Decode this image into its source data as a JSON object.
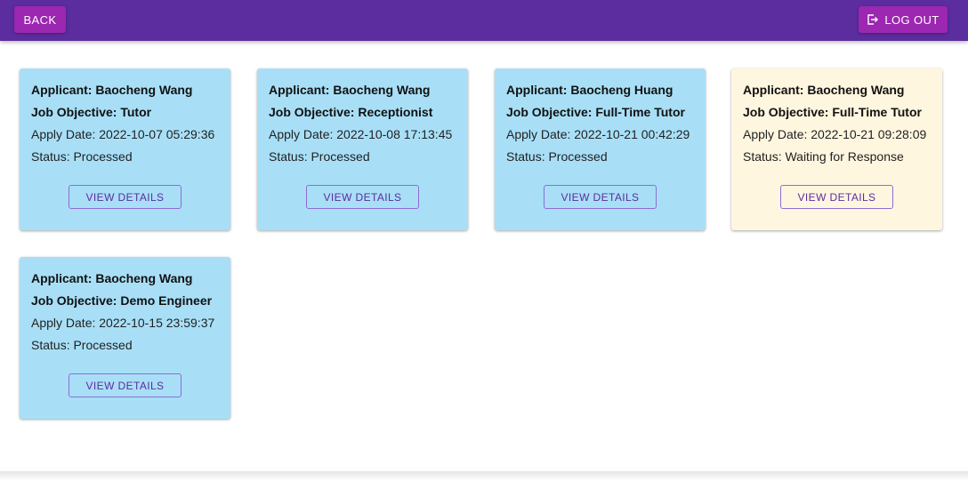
{
  "colors": {
    "appbar": "#5b2d9e",
    "top_button": "#9c27b0",
    "card_processed": "#a8dff7",
    "card_waiting": "#fff6df",
    "view_button_text": "#5b2d9e"
  },
  "header": {
    "back_label": "BACK",
    "logout_label": "LOG OUT",
    "logout_icon": "logout-icon"
  },
  "applications": [
    {
      "applicant": "Applicant: Baocheng Wang",
      "objective": "Job Objective: Tutor",
      "apply_date": "Apply Date: 2022-10-07 05:29:36",
      "status": "Status: Processed",
      "button_label": "VIEW DETAILS",
      "state": "processed"
    },
    {
      "applicant": "Applicant: Baocheng Wang",
      "objective": "Job Objective: Receptionist",
      "apply_date": "Apply Date: 2022-10-08 17:13:45",
      "status": "Status: Processed",
      "button_label": "VIEW DETAILS",
      "state": "processed"
    },
    {
      "applicant": "Applicant: Baocheng Huang",
      "objective": "Job Objective: Full-Time Tutor",
      "apply_date": "Apply Date: 2022-10-21 00:42:29",
      "status": "Status: Processed",
      "button_label": "VIEW DETAILS",
      "state": "processed"
    },
    {
      "applicant": "Applicant: Baocheng Wang",
      "objective": "Job Objective: Full-Time Tutor",
      "apply_date": "Apply Date: 2022-10-21 09:28:09",
      "status": "Status: Waiting for Response",
      "button_label": "VIEW DETAILS",
      "state": "waiting"
    },
    {
      "applicant": "Applicant: Baocheng Wang",
      "objective": "Job Objective: Demo Engineer",
      "apply_date": "Apply Date: 2022-10-15 23:59:37",
      "status": "Status: Processed",
      "button_label": "VIEW DETAILS",
      "state": "processed"
    }
  ]
}
